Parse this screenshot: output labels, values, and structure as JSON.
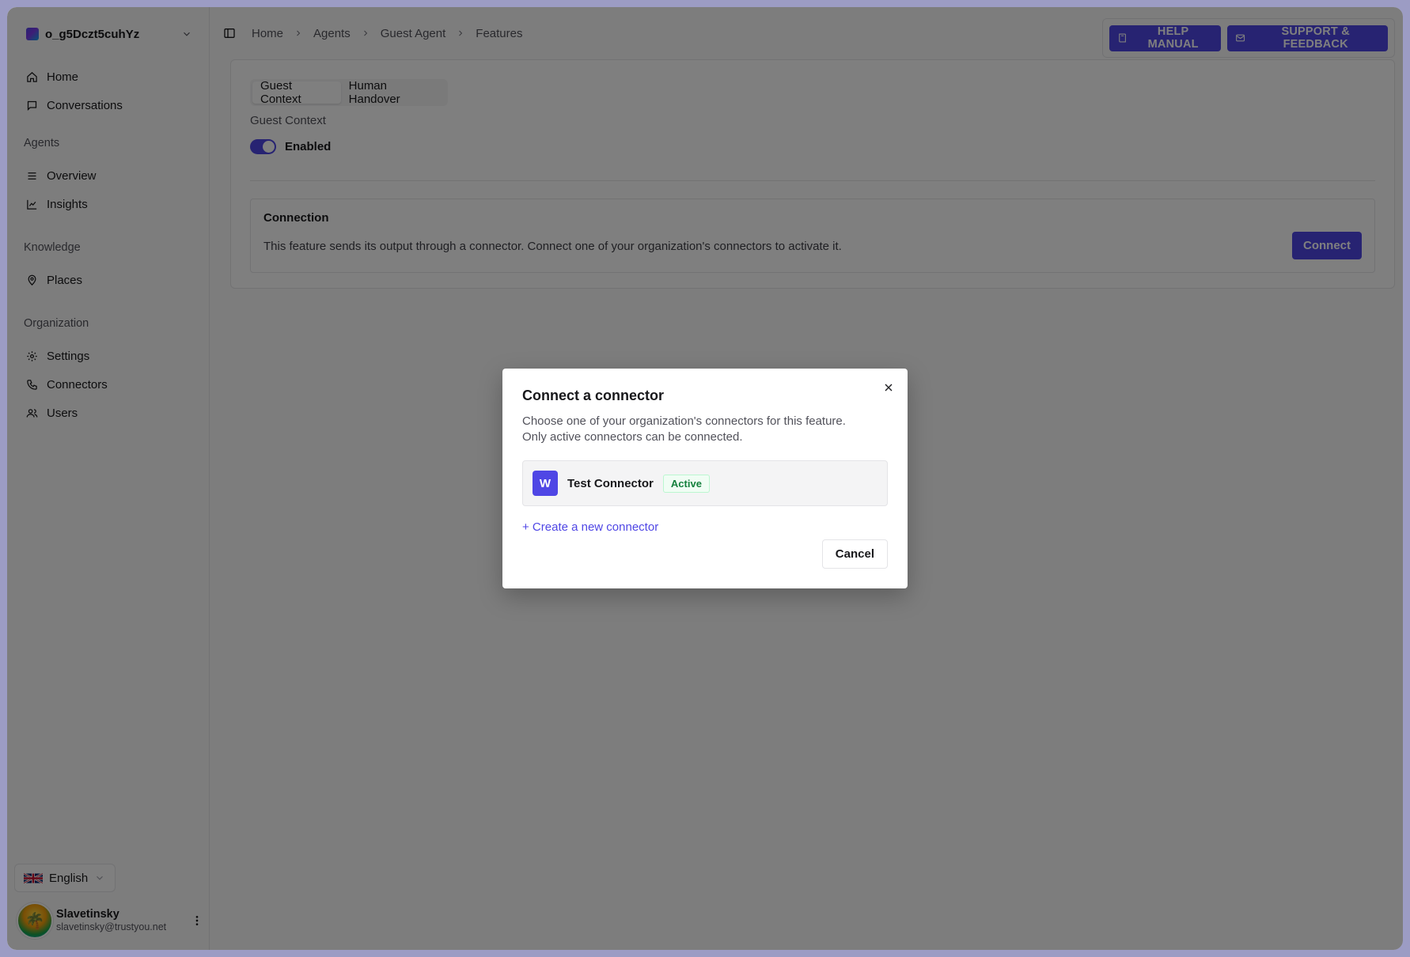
{
  "sidebar": {
    "org_name": "o_g5Dczt5cuhYz",
    "items_top": [
      {
        "label": "Home",
        "icon": "home-icon"
      },
      {
        "label": "Conversations",
        "icon": "chat-icon"
      }
    ],
    "groups": [
      {
        "title": "Agents",
        "items": [
          {
            "label": "Overview",
            "icon": "list-icon"
          },
          {
            "label": "Insights",
            "icon": "chart-line-icon"
          }
        ]
      },
      {
        "title": "Knowledge",
        "items": [
          {
            "label": "Places",
            "icon": "map-pin-icon"
          }
        ]
      },
      {
        "title": "Organization",
        "items": [
          {
            "label": "Settings",
            "icon": "gear-icon"
          },
          {
            "label": "Connectors",
            "icon": "phone-icon"
          },
          {
            "label": "Users",
            "icon": "users-icon"
          }
        ]
      }
    ],
    "language": "English",
    "user": {
      "name": "Slavetinsky",
      "email": "slavetinsky@trustyou.net"
    }
  },
  "breadcrumb": [
    "Home",
    "Agents",
    "Guest Agent",
    "Features"
  ],
  "top_actions": {
    "help": "HELP MANUAL",
    "support": "SUPPORT & FEEDBACK"
  },
  "feature": {
    "tabs": [
      "Guest Context",
      "Human Handover"
    ],
    "active_tab": "Guest Context",
    "section_label": "Guest Context",
    "toggle_label": "Enabled",
    "connection": {
      "title": "Connection",
      "description": "This feature sends its output through a connector. Connect one of your organization's connectors to activate it.",
      "button": "Connect"
    }
  },
  "modal": {
    "title": "Connect a connector",
    "description": "Choose one of your organization's connectors for this feature. Only active connectors can be connected.",
    "connector": {
      "initial": "W",
      "name": "Test Connector",
      "status": "Active"
    },
    "create_link": "+ Create a new connector",
    "cancel": "Cancel"
  },
  "colors": {
    "accent": "#4f46e5",
    "active_badge": "#15803d"
  }
}
